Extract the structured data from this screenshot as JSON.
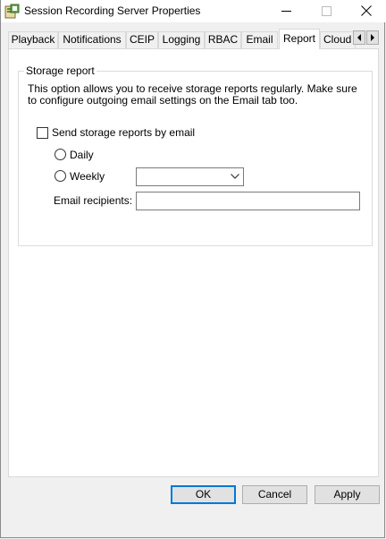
{
  "window": {
    "title": "Session Recording Server Properties",
    "icon": "server-properties-icon"
  },
  "tabs": [
    {
      "label": "Playback",
      "active": false
    },
    {
      "label": "Notifications",
      "active": false
    },
    {
      "label": "CEIP",
      "active": false
    },
    {
      "label": "Logging",
      "active": false
    },
    {
      "label": "RBAC",
      "active": false
    },
    {
      "label": "Email",
      "active": false
    },
    {
      "label": "Report",
      "active": true
    },
    {
      "label": "Cloud",
      "active": false
    }
  ],
  "report": {
    "group_title": "Storage report",
    "description": "This option allows you to receive storage reports regularly. Make sure to configure outgoing email settings on the Email tab too.",
    "send_checkbox_label": "Send storage reports by email",
    "send_checked": false,
    "daily_label": "Daily",
    "weekly_label": "Weekly",
    "weekly_selected": "",
    "recipients_label": "Email recipients:",
    "recipients_value": ""
  },
  "buttons": {
    "ok": "OK",
    "cancel": "Cancel",
    "apply": "Apply"
  },
  "colors": {
    "accent": "#0078d7",
    "window_bg": "#f0f0f0",
    "panel_bg": "#ffffff"
  }
}
